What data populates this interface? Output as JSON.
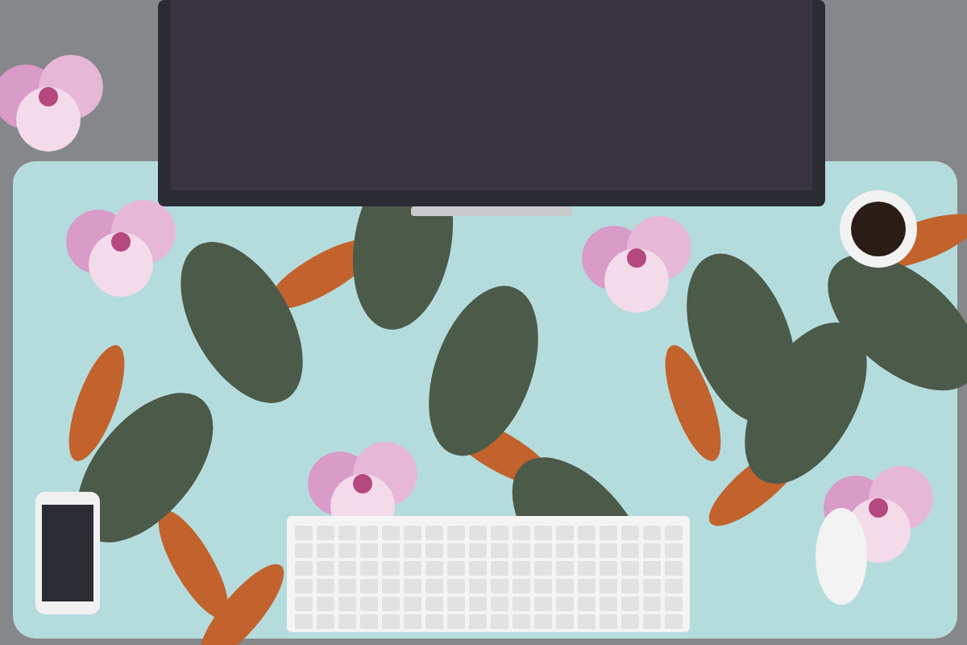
{
  "photo": {
    "kind": "desk-mat-scene"
  }
}
